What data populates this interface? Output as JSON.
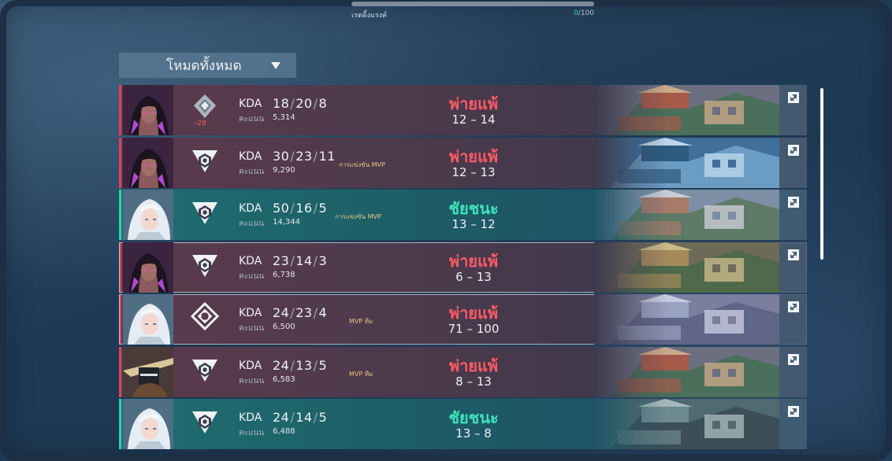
{
  "rank_progress": {
    "label": "เรตติ้งแรงค์",
    "current": "0",
    "max": "/100",
    "fraction": 0
  },
  "filter": {
    "label": "โหมดทั้งหมด",
    "icon": "dropdown-caret-icon"
  },
  "labels": {
    "kda": "KDA",
    "score": "คะแนน"
  },
  "colors": {
    "loss_text": "#ff5a63",
    "win_text": "#3fe2bb",
    "loss_edge": "#d7475d",
    "win_edge": "#2fd0ad",
    "mvp_badge": "#e8c77b",
    "rr_loss": "#ef5b63"
  },
  "matches": [
    {
      "outcome": "loss",
      "result": "พ่ายแพ้",
      "score": "12 – 14",
      "kills": "18",
      "deaths": "20",
      "assists": "8",
      "combat_score": "5,314",
      "badge": "",
      "rank_icon": "diamond-rank-icon",
      "rr_change": "-28"
    },
    {
      "outcome": "loss",
      "result": "พ่ายแพ้",
      "score": "12 – 13",
      "kills": "30",
      "deaths": "23",
      "assists": "11",
      "combat_score": "9,290",
      "badge": "การแข่งขัน MVP",
      "rank_icon": "unrated-mode-icon",
      "rr_change": ""
    },
    {
      "outcome": "win",
      "result": "ชัยชนะ",
      "score": "13 – 12",
      "kills": "50",
      "deaths": "16",
      "assists": "5",
      "combat_score": "14,344",
      "badge": "การแข่งขัน MVP",
      "rank_icon": "unrated-mode-icon",
      "rr_change": ""
    },
    {
      "outcome": "loss",
      "result": "พ่ายแพ้",
      "score": "6 – 13",
      "kills": "23",
      "deaths": "14",
      "assists": "3",
      "combat_score": "6,738",
      "badge": "",
      "rank_icon": "unrated-mode-icon",
      "rr_change": ""
    },
    {
      "outcome": "loss",
      "result": "พ่ายแพ้",
      "score": "71 – 100",
      "kills": "24",
      "deaths": "23",
      "assists": "4",
      "combat_score": "6,500",
      "badge": "MVP ทีม",
      "rank_icon": "deathmatch-mode-icon",
      "rr_change": ""
    },
    {
      "outcome": "loss",
      "result": "พ่ายแพ้",
      "score": "8 – 13",
      "kills": "24",
      "deaths": "13",
      "assists": "5",
      "combat_score": "6,583",
      "badge": "MVP ทีม",
      "rank_icon": "unrated-mode-icon",
      "rr_change": ""
    },
    {
      "outcome": "win",
      "result": "ชัยชนะ",
      "score": "13 – 8",
      "kills": "24",
      "deaths": "14",
      "assists": "5",
      "combat_score": "6,488",
      "badge": "",
      "rank_icon": "unrated-mode-icon",
      "rr_change": ""
    }
  ]
}
